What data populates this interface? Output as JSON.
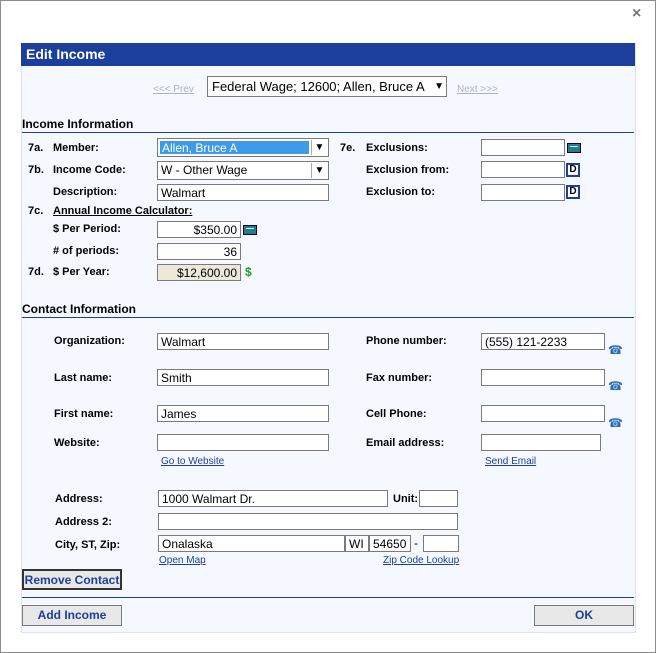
{
  "dialog": {
    "title": "Edit Income",
    "close_icon": "×"
  },
  "nav": {
    "prev": "<<< Prev",
    "next": "Next >>>",
    "selected": "Federal Wage; 12600; Allen, Bruce A"
  },
  "income": {
    "section": "Income Information",
    "member_num": "7a.",
    "member_label": "Member:",
    "member_value": "Allen, Bruce A",
    "code_num": "7b.",
    "code_label": "Income Code:",
    "code_value": "W - Other Wage",
    "desc_label": "Description:",
    "desc_value": "Walmart",
    "calc_num": "7c.",
    "calc_label": "Annual Income Calculator:",
    "per_period_label": "$ Per Period:",
    "per_period_value": "$350.00",
    "periods_label": "# of periods:",
    "periods_value": "36",
    "year_num": "7d.",
    "year_label": "$ Per Year:",
    "year_value": "$12,600.00",
    "excl_num": "7e.",
    "excl_label": "Exclusions:",
    "excl_value": "",
    "excl_from_label": "Exclusion from:",
    "excl_from_value": "",
    "excl_to_label": "Exclusion to:",
    "excl_to_value": "",
    "date_icon": "D"
  },
  "contact": {
    "section": "Contact Information",
    "org_label": "Organization:",
    "org_value": "Walmart",
    "last_label": "Last name:",
    "last_value": "Smith",
    "first_label": "First name:",
    "first_value": "James",
    "web_label": "Website:",
    "web_value": "",
    "web_link": "Go to Website",
    "phone_label": "Phone number:",
    "phone_value": "(555) 121-2233",
    "fax_label": "Fax number:",
    "fax_value": "",
    "cell_label": "Cell Phone:",
    "cell_value": "",
    "email_label": "Email address:",
    "email_value": "",
    "email_link": "Send Email",
    "addr_label": "Address:",
    "addr_value": "1000 Walmart Dr.",
    "unit_label": "Unit:",
    "unit_value": "",
    "addr2_label": "Address 2:",
    "addr2_value": "",
    "csz_label": "City, ST, Zip:",
    "city_value": "Onalaska",
    "state_value": "WI",
    "zip_value": "54650",
    "zip_sep": "-",
    "zip4_value": "",
    "map_link": "Open Map",
    "zip_link": "Zip Code Lookup",
    "remove_btn": "Remove Contact"
  },
  "footer": {
    "add_btn": "Add Income",
    "ok_btn": "OK"
  }
}
